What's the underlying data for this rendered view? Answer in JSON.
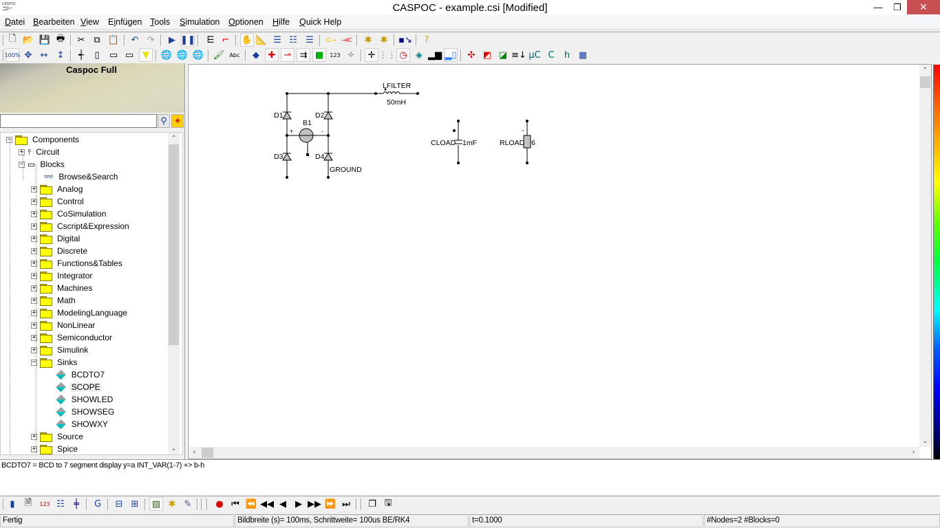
{
  "window": {
    "app_icon_label": "CASPOC",
    "title": "CASPOC - example.csi [Modified]",
    "minimize_glyph": "—",
    "maximize_glyph": "❐",
    "close_glyph": "✕"
  },
  "menu": [
    {
      "label": "Datei",
      "mnemonic": "D"
    },
    {
      "label": "Bearbeiten",
      "mnemonic": "B"
    },
    {
      "label": "View",
      "mnemonic": "V"
    },
    {
      "label": "Einfügen",
      "mnemonic": "i"
    },
    {
      "label": "Tools",
      "mnemonic": "T"
    },
    {
      "label": "Simulation",
      "mnemonic": "S"
    },
    {
      "label": "Optionen",
      "mnemonic": "O"
    },
    {
      "label": "Hilfe",
      "mnemonic": "H"
    },
    {
      "label": "Quick Help",
      "mnemonic": "Q"
    }
  ],
  "toolbar1": [
    {
      "name": "new-file",
      "glyph": "🗋"
    },
    {
      "name": "open-folder",
      "glyph": "📂"
    },
    {
      "name": "save",
      "glyph": "💾"
    },
    {
      "name": "print",
      "glyph": "🖶"
    },
    {
      "name": "cut",
      "glyph": "✂"
    },
    {
      "name": "copy",
      "glyph": "⧉"
    },
    {
      "name": "paste",
      "glyph": "📋"
    },
    {
      "name": "undo",
      "glyph": "↶"
    },
    {
      "name": "redo",
      "glyph": "↷"
    },
    {
      "name": "run",
      "glyph": "▶"
    },
    {
      "name": "pause",
      "glyph": "❚❚"
    },
    {
      "name": "signal-list",
      "glyph": "⋿"
    },
    {
      "name": "waveform",
      "glyph": "⌐"
    },
    {
      "name": "hand",
      "glyph": "✋"
    },
    {
      "name": "edit-draw",
      "glyph": "📐"
    },
    {
      "name": "list",
      "glyph": "☰"
    },
    {
      "name": "list-check",
      "glyph": "☷"
    },
    {
      "name": "list-sort",
      "glyph": "☰"
    },
    {
      "name": "export-ic",
      "glyph": "IC→"
    },
    {
      "name": "import-ic",
      "glyph": "→IC"
    },
    {
      "name": "wizard-1",
      "glyph": "✱"
    },
    {
      "name": "wizard-2",
      "glyph": "✱"
    },
    {
      "name": "hierarchy",
      "glyph": "▪↘"
    },
    {
      "name": "help",
      "glyph": "?"
    }
  ],
  "toolbar2": [
    {
      "name": "zoom-100",
      "glyph": "100%"
    },
    {
      "name": "zoom-fit",
      "glyph": "✥"
    },
    {
      "name": "zoom-width",
      "glyph": "↔"
    },
    {
      "name": "zoom-height",
      "glyph": "↕"
    },
    {
      "name": "node",
      "glyph": "┽"
    },
    {
      "name": "component",
      "glyph": "▯"
    },
    {
      "name": "block-1",
      "glyph": "▭"
    },
    {
      "name": "block-2",
      "glyph": "▭"
    },
    {
      "name": "probe",
      "glyph": "▼"
    },
    {
      "name": "globe-1",
      "glyph": "🌐"
    },
    {
      "name": "globe-2",
      "glyph": "🌐"
    },
    {
      "name": "globe-3",
      "glyph": "🌐"
    },
    {
      "name": "brush",
      "glyph": "🖌"
    },
    {
      "name": "text",
      "glyph": "Abc"
    },
    {
      "name": "shape-3d",
      "glyph": "◆"
    },
    {
      "name": "cross-node",
      "glyph": "✚"
    },
    {
      "name": "arrow-red",
      "glyph": "⇀"
    },
    {
      "name": "arrow-multi",
      "glyph": "⇉"
    },
    {
      "name": "block-out",
      "glyph": "■"
    },
    {
      "name": "numbers",
      "glyph": "123"
    },
    {
      "name": "magic-wand",
      "glyph": "✧"
    },
    {
      "name": "crosshair",
      "glyph": "✛"
    },
    {
      "name": "grid",
      "glyph": "⋮⋮"
    },
    {
      "name": "clock",
      "glyph": "◷"
    },
    {
      "name": "paint-bucket",
      "glyph": "◈"
    },
    {
      "name": "level-1",
      "glyph": "▂▆"
    },
    {
      "name": "level-2",
      "glyph": "▂▯"
    },
    {
      "name": "fit-all",
      "glyph": "✣"
    },
    {
      "name": "overlay-1",
      "glyph": "◩"
    },
    {
      "name": "overlay-2",
      "glyph": "◪"
    },
    {
      "name": "sort-down",
      "glyph": "≡↓"
    },
    {
      "name": "chip-uc",
      "glyph": "μC"
    },
    {
      "name": "chip-c",
      "glyph": "C"
    },
    {
      "name": "chip-h",
      "glyph": "h"
    },
    {
      "name": "table",
      "glyph": "▦"
    }
  ],
  "library": {
    "banner_title": "Caspoc Full",
    "search_value": "",
    "search_button_glyph": "⚲",
    "browse_button_glyph": "◈"
  },
  "tree": {
    "root": "Components",
    "circuit": "Circuit",
    "blocks": "Blocks",
    "browse": "Browse&Search",
    "folders_before_sinks": [
      "Analog",
      "Control",
      "CoSimulation",
      "Cscript&Expression",
      "Digital",
      "Discrete",
      "Functions&Tables",
      "Integrator",
      "Machines",
      "Math",
      "ModelingLanguage",
      "NonLinear",
      "Semiconductor",
      "Simulink"
    ],
    "sinks": "Sinks",
    "sink_items": [
      "BCDTO7",
      "SCOPE",
      "SHOWLED",
      "SHOWSEG",
      "SHOWXY"
    ],
    "selected_item": "SCOPE",
    "folders_after_sinks": [
      "Source",
      "Spice"
    ],
    "expand_glyph": "+",
    "collapse_glyph": "−",
    "scroll_up_glyph": "⌃",
    "scroll_down_glyph": "⌄"
  },
  "schematic": {
    "labels": {
      "lfilter": "LFILTER",
      "lfilter_value": "50mH",
      "d1": "D1",
      "d2": "D2",
      "d3": "D3",
      "d4": "D4",
      "b1": "B1",
      "plus": "+",
      "minus": "-",
      "ground": "GROUND",
      "cload": "CLOAD",
      "cload_value": "1mF",
      "rload": "RLOAD",
      "rload_value": "6"
    }
  },
  "canvas_scroll": {
    "up": "⌃",
    "down": "⌄",
    "left": "‹",
    "right": "›"
  },
  "description": "BCDTO7 = BCD to 7 segment display y=a INT_VAR(1-7) +> b-h",
  "toolbar3": [
    {
      "name": "block-color",
      "glyph": "▮"
    },
    {
      "name": "report",
      "glyph": "🗎"
    },
    {
      "name": "counter-123",
      "glyph": "123"
    },
    {
      "name": "network",
      "glyph": "☷"
    },
    {
      "name": "component-bar",
      "glyph": "╪"
    },
    {
      "name": "refresh-g",
      "glyph": "G"
    },
    {
      "name": "window-split-1",
      "glyph": "⊟"
    },
    {
      "name": "window-split-2",
      "glyph": "⊞"
    },
    {
      "name": "image-1",
      "glyph": "▨"
    },
    {
      "name": "image-2",
      "glyph": "✱"
    },
    {
      "name": "pen-tool",
      "glyph": "✎"
    },
    {
      "name": "record",
      "glyph": "●"
    },
    {
      "name": "first",
      "glyph": "⏮"
    },
    {
      "name": "fast-back",
      "glyph": "⏪"
    },
    {
      "name": "back",
      "glyph": "◀◀"
    },
    {
      "name": "step-back",
      "glyph": "◀"
    },
    {
      "name": "play",
      "glyph": "▶"
    },
    {
      "name": "step-forward",
      "glyph": "▶▶"
    },
    {
      "name": "fast-forward",
      "glyph": "⏩"
    },
    {
      "name": "last",
      "glyph": "⏭"
    },
    {
      "name": "windows",
      "glyph": "❐"
    },
    {
      "name": "save-all",
      "glyph": "🖫"
    }
  ],
  "status": {
    "state": "Fertig",
    "sim_params": "Bildbreite (s)= 100ms, Schrittweite= 100us BE/RK4",
    "time": "t=0.1000",
    "counts": "#Nodes=2 #Blocks=0"
  }
}
